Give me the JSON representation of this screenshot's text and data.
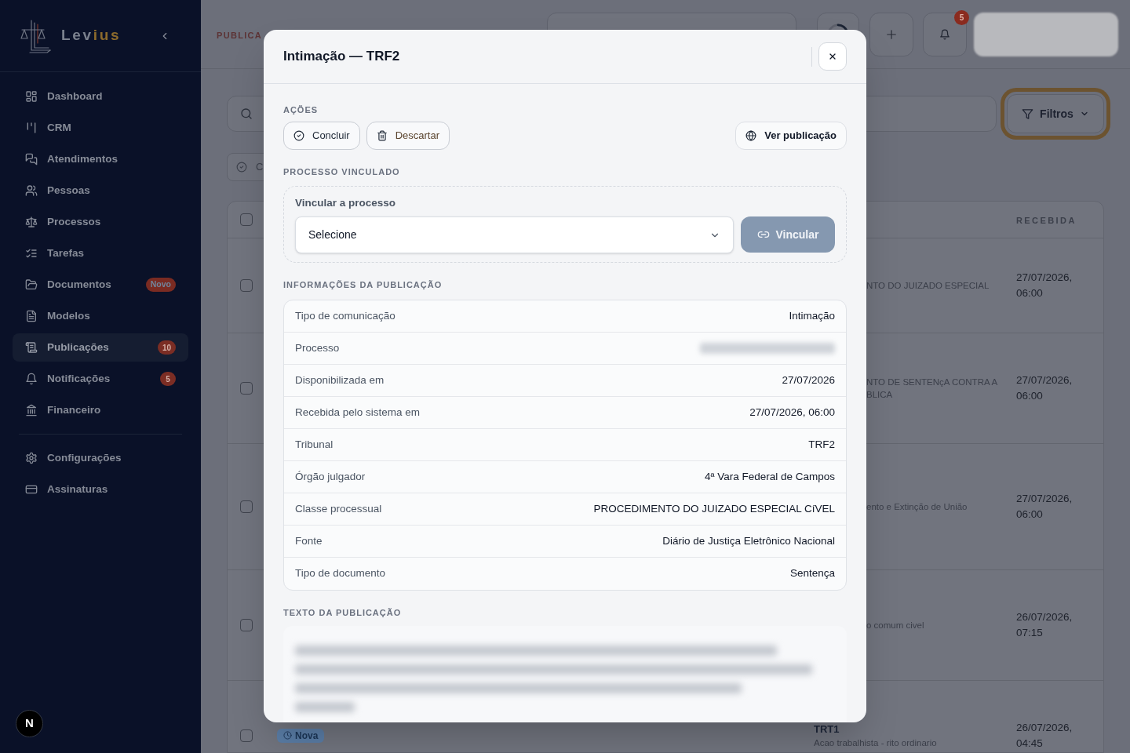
{
  "sidebar": {
    "brand": [
      {
        "text": "Lev",
        "accent": false
      },
      {
        "text": "ius",
        "accent": true
      }
    ],
    "sections": [
      {
        "items": [
          {
            "label": "Dashboard",
            "selected": false
          },
          {
            "label": "CRM",
            "selected": false
          },
          {
            "label": "Atendimentos",
            "selected": false
          },
          {
            "label": "Pessoas",
            "selected": false
          },
          {
            "label": "Processos",
            "selected": false
          },
          {
            "label": "Tarefas",
            "selected": false
          },
          {
            "label": "Documentos",
            "selected": false,
            "badge": {
              "text": "Novo",
              "kind": "label"
            }
          },
          {
            "label": "Modelos",
            "selected": false
          },
          {
            "label": "Publicações",
            "selected": true,
            "badge": {
              "text": "10",
              "kind": "count"
            }
          },
          {
            "label": "Notificações",
            "selected": false,
            "badge": {
              "text": "5",
              "kind": "count"
            }
          },
          {
            "label": "Financeiro",
            "selected": false
          }
        ]
      },
      {
        "items": [
          {
            "label": "Configurações",
            "selected": false
          },
          {
            "label": "Assinaturas",
            "selected": false
          }
        ]
      }
    ]
  },
  "dev_indicator": {
    "label": "N"
  },
  "header": {
    "title": "PUBLICA",
    "notifications": {
      "count": "5"
    }
  },
  "toolbar": {
    "filters_button": {
      "label": "Filtros"
    },
    "chip": {
      "label": "C"
    }
  },
  "table": {
    "select_all": {
      "checked": false
    },
    "columns": [
      {
        "label": "RECEBIDA"
      }
    ],
    "rows": [
      {
        "kind": "covered",
        "checked": false,
        "class_lines": [
          "NTO DO JUIZADO ESPECIAL"
        ],
        "received": "27/07/2026, 06:00"
      },
      {
        "kind": "covered",
        "checked": false,
        "class_lines": [
          "NTO DE SENTENçA CONTRA A",
          "BLICA"
        ],
        "received": "27/07/2026, 06:00"
      },
      {
        "kind": "covered",
        "checked": false,
        "class_lines": [
          "ento e Extinção de União"
        ],
        "received": "27/07/2026, 06:00"
      },
      {
        "kind": "covered",
        "checked": false,
        "class_lines": [
          "o comum civel"
        ],
        "received": "26/07/2026, 07:15"
      },
      {
        "kind": "full",
        "checked": false,
        "status": "Nova",
        "court": "TRT1",
        "class_lines": [
          "Acao trabalhista - rito ordinario"
        ],
        "received": "26/07/2026, 04:45"
      }
    ]
  },
  "modal": {
    "title": "Intimação — TRF2",
    "actions_heading": "AÇÕES",
    "actions": [
      {
        "label": "Concluir",
        "kind": "complete"
      },
      {
        "label": "Descartar",
        "kind": "discard"
      },
      {
        "label": "Ver publicação",
        "kind": "open"
      }
    ],
    "link_section": {
      "heading": "PROCESSO VINCULADO",
      "label": "Vincular a processo",
      "select": {
        "value": "Selecione"
      },
      "button": {
        "label": "Vincular",
        "disabled": true
      }
    },
    "info": {
      "heading": "INFORMAÇÕES DA PUBLICAÇÃO",
      "rows": [
        {
          "label": "Tipo de comunicação",
          "value": "Intimação"
        },
        {
          "label": "Processo",
          "redacted": true
        },
        {
          "label": "Disponibilizada em",
          "value": "27/07/2026"
        },
        {
          "label": "Recebida pelo sistema em",
          "value": "27/07/2026, 06:00"
        },
        {
          "label": "Tribunal",
          "value": "TRF2"
        },
        {
          "label": "Órgão julgador",
          "value": "4ª Vara Federal de Campos"
        },
        {
          "label": "Classe processual",
          "value": "PROCEDIMENTO DO JUIZADO ESPECIAL CíVEL"
        },
        {
          "label": "Fonte",
          "value": "Diário de Justiça Eletrônico Nacional"
        },
        {
          "label": "Tipo de documento",
          "value": "Sentença"
        }
      ]
    },
    "text_section": {
      "heading": "TEXTO DA PUBLICAÇÃO"
    }
  }
}
